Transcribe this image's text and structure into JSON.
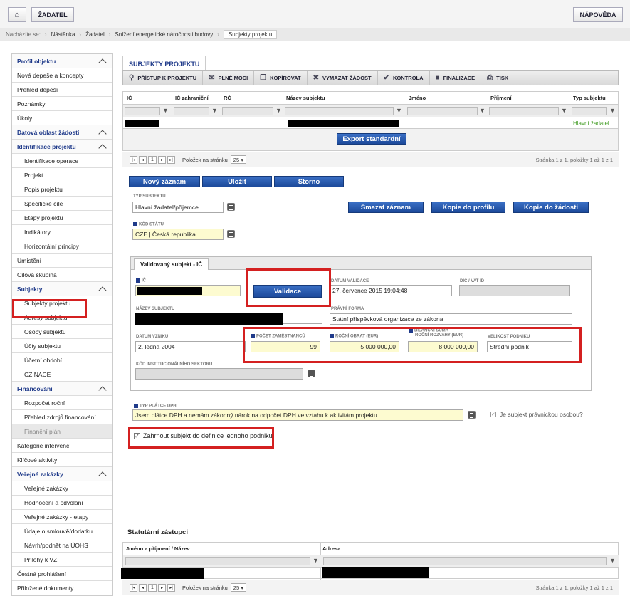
{
  "topbar": {
    "home_label": "",
    "zadatel": "ŽADATEL",
    "help": "NÁPOVĚDA"
  },
  "breadcrumb": {
    "prefix": "Nacházíte se:",
    "items": [
      "Nástěnka",
      "Žadatel",
      "Snížení energetické náročnosti budovy",
      "Subjekty projektu"
    ]
  },
  "sidebar": {
    "items": [
      {
        "label": "Profil objektu",
        "type": "sec"
      },
      {
        "label": "Nová depeše a koncepty",
        "type": "item"
      },
      {
        "label": "Přehled depeší",
        "type": "item"
      },
      {
        "label": "Poznámky",
        "type": "item"
      },
      {
        "label": "Úkoly",
        "type": "item"
      },
      {
        "label": "Datová oblast žádosti",
        "type": "sec"
      },
      {
        "label": "Identifikace projektu",
        "type": "sec"
      },
      {
        "label": "Identifikace operace",
        "type": "sub"
      },
      {
        "label": "Projekt",
        "type": "sub"
      },
      {
        "label": "Popis projektu",
        "type": "sub"
      },
      {
        "label": "Specifické cíle",
        "type": "sub"
      },
      {
        "label": "Etapy projektu",
        "type": "sub"
      },
      {
        "label": "Indikátory",
        "type": "sub"
      },
      {
        "label": "Horizontální principy",
        "type": "sub"
      },
      {
        "label": "Umístění",
        "type": "item"
      },
      {
        "label": "Cílová skupina",
        "type": "item"
      },
      {
        "label": "Subjekty",
        "type": "sec"
      },
      {
        "label": "Subjekty projektu",
        "type": "sub"
      },
      {
        "label": "Adresy subjektu",
        "type": "sub"
      },
      {
        "label": "Osoby subjektu",
        "type": "sub"
      },
      {
        "label": "Účty subjektu",
        "type": "sub"
      },
      {
        "label": "Účetní období",
        "type": "sub"
      },
      {
        "label": "CZ NACE",
        "type": "sub"
      },
      {
        "label": "Financování",
        "type": "sec"
      },
      {
        "label": "Rozpočet roční",
        "type": "sub"
      },
      {
        "label": "Přehled zdrojů financování",
        "type": "sub"
      },
      {
        "label": "Finanční plán",
        "type": "subgrey"
      },
      {
        "label": "Kategorie intervencí",
        "type": "item"
      },
      {
        "label": "Klíčové aktivity",
        "type": "item"
      },
      {
        "label": "Veřejné zakázky",
        "type": "sec"
      },
      {
        "label": "Veřejné zakázky",
        "type": "sub"
      },
      {
        "label": "Hodnocení a odvolání",
        "type": "sub"
      },
      {
        "label": "Veřejné zakázky - etapy",
        "type": "sub"
      },
      {
        "label": "Údaje o smlouvě/dodatku",
        "type": "sub"
      },
      {
        "label": "Návrh/podnět na ÚOHS",
        "type": "sub"
      },
      {
        "label": "Přílohy k VZ",
        "type": "sub"
      },
      {
        "label": "Čestná prohlášení",
        "type": "item"
      },
      {
        "label": "Přiložené dokumenty",
        "type": "item"
      }
    ]
  },
  "main": {
    "tab": "SUBJEKTY PROJEKTU",
    "toolbar": [
      "PŘÍSTUP K PROJEKTU",
      "PLNÉ MOCI",
      "KOPÍROVAT",
      "VYMAZAT ŽÁDOST",
      "KONTROLA",
      "FINALIZACE",
      "TISK"
    ],
    "grid": {
      "columns": [
        "IČ",
        "IČ zahraniční",
        "RČ",
        "Název subjektu",
        "Jméno",
        "Příjmení",
        "Typ subjektu"
      ],
      "row_type": "Hlavní žadatel..."
    },
    "export": "Export standardní",
    "pager": {
      "page": "1",
      "per_page_label": "Položek na stránku",
      "per_page": "25",
      "info": "Stránka 1 z 1, položky 1 až 1 z 1"
    },
    "buttons": {
      "new": "Nový záznam",
      "save": "Uložit",
      "cancel": "Storno",
      "delete": "Smazat záznam",
      "copy_profile": "Kopie do profilu",
      "copy_request": "Kopie do žádosti"
    },
    "form": {
      "typ_subjektu_label": "TYP SUBJEKTU",
      "typ_subjektu": "Hlavní žadatel/příjemce",
      "kod_statu_label": "KÓD STÁTU",
      "kod_statu": "CZE | Česká republika",
      "inner_tab": "Validovaný subjekt - IČ",
      "ic_label": "IČ",
      "validace": "Validace",
      "datum_validace_label": "DATUM VALIDACE",
      "datum_validace": "27. července 2015 19:04:48",
      "dic_label": "DIČ / VAT ID",
      "nazev_label": "NÁZEV SUBJEKTU",
      "pravni_forma_label": "PRÁVNÍ FORMA",
      "pravni_forma": "Státní příspěvková organizace ze zákona",
      "datum_vzniku_label": "DATUM VZNIKU",
      "datum_vzniku": "2. ledna 2004",
      "pocet_label": "POČET ZAMĚSTNANCŮ",
      "pocet": "99",
      "obrat_label": "ROČNÍ OBRAT (EUR)",
      "obrat": "5 000 000,00",
      "bilance_label_1": "BILANČNÍ SUMA",
      "bilance_label_2": "ROČNÍ ROZVAHY (EUR)",
      "bilance": "8 000 000,00",
      "velikost_label": "VELIKOST PODNIKU",
      "velikost": "Střední podnik",
      "sektor_label": "KÓD INSTITUCIONÁLNÍHO SEKTORU",
      "platce_label": "TYP PLÁTCE DPH",
      "platce": "Jsem plátce DPH a nemám zákonný nárok na odpočet DPH ve vztahu k aktivitám projektu",
      "pravnicka": "Je subjekt právnickou osobou?",
      "zahrnout": "Zahrnout subjekt do definice jednoho podniku"
    },
    "statutory": {
      "title": "Statutární zástupci",
      "col1": "Jméno a příjmení / Název",
      "col2": "Adresa"
    }
  }
}
